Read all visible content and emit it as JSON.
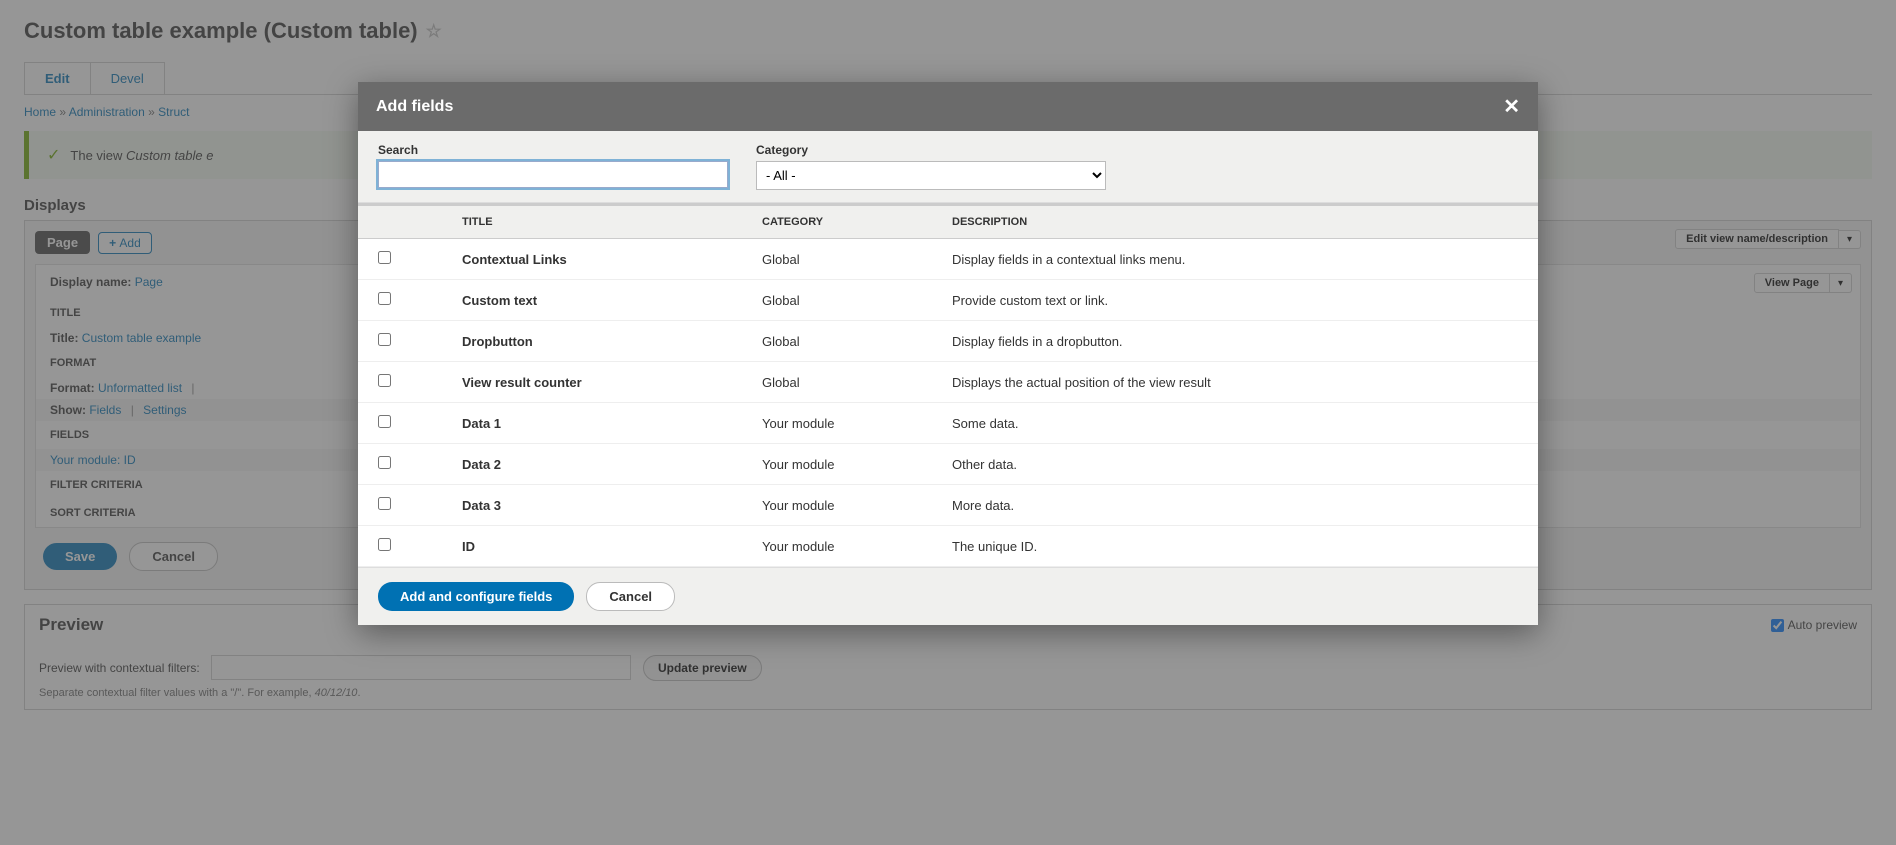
{
  "page": {
    "title": "Custom table example (Custom table)"
  },
  "tabs": {
    "edit": "Edit",
    "devel": "Devel"
  },
  "breadcrumb": {
    "home": "Home",
    "admin": "Administration",
    "struct": "Struct",
    "sep": "»"
  },
  "message": {
    "prefix": "The view ",
    "italic": "Custom table e"
  },
  "displays": {
    "heading": "Displays",
    "page_tab": "Page",
    "add": "Add",
    "edit_view": "Edit view name/description",
    "caret": "▾",
    "view_page": "View Page"
  },
  "detail": {
    "display_name_label": "Display name:",
    "display_name_value": "Page",
    "title_section": "TITLE",
    "title_label": "Title:",
    "title_value": "Custom table example",
    "format_section": "FORMAT",
    "format_label": "Format:",
    "format_value": "Unformatted list",
    "show_label": "Show:",
    "show_value": "Fields",
    "settings": "Settings",
    "pipe": "|",
    "fields_section": "FIELDS",
    "field1": "Your module: ID",
    "filter_section": "FILTER CRITERIA",
    "sort_section": "SORT CRITERIA"
  },
  "actions": {
    "save": "Save",
    "cancel": "Cancel"
  },
  "preview": {
    "title": "Preview",
    "auto": "Auto preview",
    "context_label": "Preview with contextual filters:",
    "update": "Update preview",
    "hint_pre": "Separate contextual filter values with a \"/\". For example, ",
    "hint_em": "40/12/10",
    "hint_post": "."
  },
  "modal": {
    "title": "Add fields",
    "search_label": "Search",
    "category_label": "Category",
    "category_value": "- All -",
    "th_title": "TITLE",
    "th_category": "CATEGORY",
    "th_desc": "DESCRIPTION",
    "rows": [
      {
        "title": "Contextual Links",
        "cat": "Global",
        "desc": "Display fields in a contextual links menu."
      },
      {
        "title": "Custom text",
        "cat": "Global",
        "desc": "Provide custom text or link."
      },
      {
        "title": "Dropbutton",
        "cat": "Global",
        "desc": "Display fields in a dropbutton."
      },
      {
        "title": "View result counter",
        "cat": "Global",
        "desc": "Displays the actual position of the view result"
      },
      {
        "title": "Data 1",
        "cat": "Your module",
        "desc": "Some data."
      },
      {
        "title": "Data 2",
        "cat": "Your module",
        "desc": "Other data."
      },
      {
        "title": "Data 3",
        "cat": "Your module",
        "desc": "More data."
      },
      {
        "title": "ID",
        "cat": "Your module",
        "desc": "The unique ID."
      }
    ],
    "add_configure": "Add and configure fields",
    "cancel": "Cancel"
  }
}
